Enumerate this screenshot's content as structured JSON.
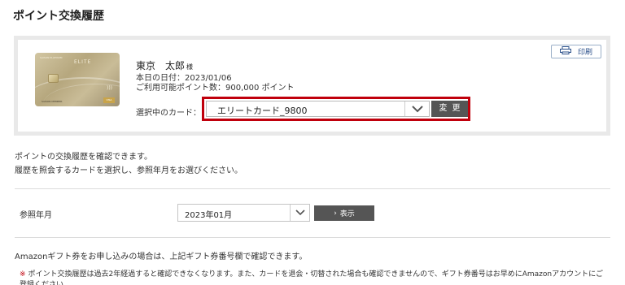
{
  "page": {
    "title": "ポイント交換履歴"
  },
  "card": {
    "image": {
      "top_text": "SAISON PLATINUM",
      "elite_text": "ELITE",
      "holder_name": "SAISON MEMBER",
      "brand": "VISA"
    },
    "user": {
      "name": "東京　太郎",
      "honorific": "様"
    },
    "date_line": "本日の日付：2023/01/06",
    "points_line": "ご利用可能ポイント数：900,000 ポイント",
    "select_label": "選択中のカード：",
    "selected_card": "エリートカード_9800",
    "change_label": "変更",
    "print_label": "印刷",
    "highlight_color": "#c0000c"
  },
  "description": {
    "line1": "ポイントの交換履歴を確認できます。",
    "line2": "履歴を照会するカードを選択し、参照年月をお選びください。"
  },
  "month": {
    "label": "参照年月",
    "selected": "2023年01月",
    "show_label": "表示"
  },
  "notes": {
    "amazon": "Amazonギフト券をお申し込みの場合は、上記ギフト券番号欄で確認できます。",
    "caution_mark": "※",
    "caution": "ポイント交換履歴は過去2年経過すると確認できなくなります。また、カードを退会・切替された場合も確認できませんので、ギフト券番号はお早めにAmazonアカウントにご登録ください。"
  },
  "icons": {
    "chevron": "chevron-down-icon",
    "printer": "printer-icon",
    "arrow": "chevron-right-icon"
  }
}
